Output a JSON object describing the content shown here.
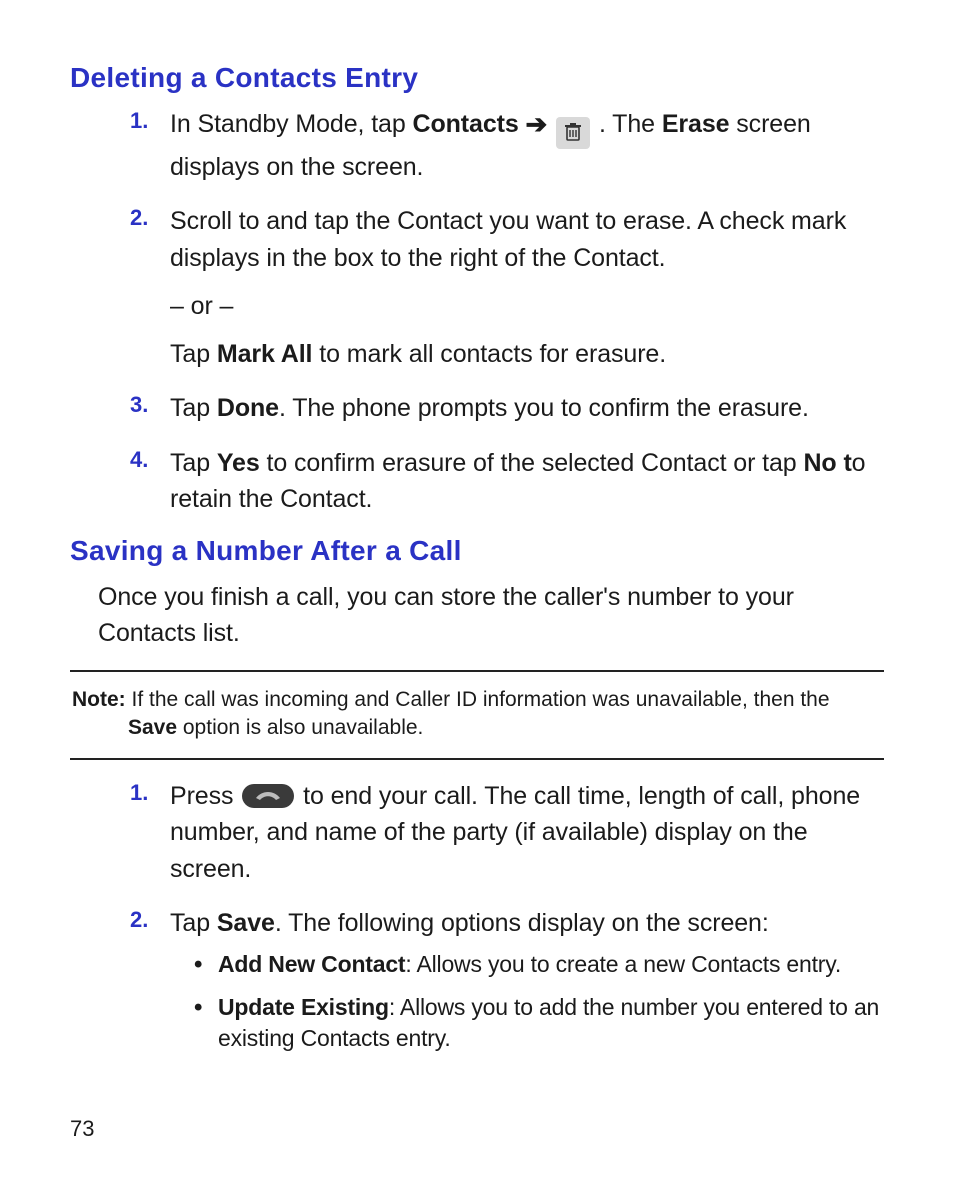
{
  "page_number": "73",
  "section1": {
    "heading": "Deleting a Contacts Entry",
    "items": [
      {
        "num": "1.",
        "pre": "In Standby Mode, tap ",
        "bold1": "Contacts",
        "mid": " . The ",
        "bold2": "Erase",
        "post": " screen displays on the screen."
      },
      {
        "num": "2.",
        "line1": "Scroll to and tap the Contact you want to erase. A check mark displays in the box to the right of the Contact.",
        "or": "– or –",
        "tap_pre": "Tap ",
        "tap_bold": "Mark All",
        "tap_post": " to mark all contacts for erasure."
      },
      {
        "num": "3.",
        "pre": "Tap ",
        "bold1": "Done",
        "post": ". The phone prompts you to confirm the erasure."
      },
      {
        "num": "4.",
        "pre": "Tap ",
        "bold1": "Yes",
        "mid": " to confirm erasure of the selected Contact or tap ",
        "bold2": "No t",
        "post": "o retain the Contact."
      }
    ]
  },
  "section2": {
    "heading": "Saving a Number After a Call",
    "intro": "Once you finish a call, you can store the caller's number to your Contacts list.",
    "note": {
      "label": "Note:",
      "pre": " If the call was incoming and Caller ID information was unavailable, then the ",
      "bold": "Save",
      "post": " option is also unavailable."
    },
    "items": [
      {
        "num": "1.",
        "pre": "Press ",
        "post": " to end your call. The call time, length of call, phone number, and name of the party (if available) display on the screen."
      },
      {
        "num": "2.",
        "pre": "Tap ",
        "bold": "Save",
        "post": ". The following options display on the screen:",
        "bullets": [
          {
            "bold": "Add New Contact",
            "text": ": Allows you to create a new Contacts entry."
          },
          {
            "bold": "Update Existing",
            "text": ": Allows you to add the number you entered to an existing Contacts entry."
          }
        ]
      }
    ]
  }
}
